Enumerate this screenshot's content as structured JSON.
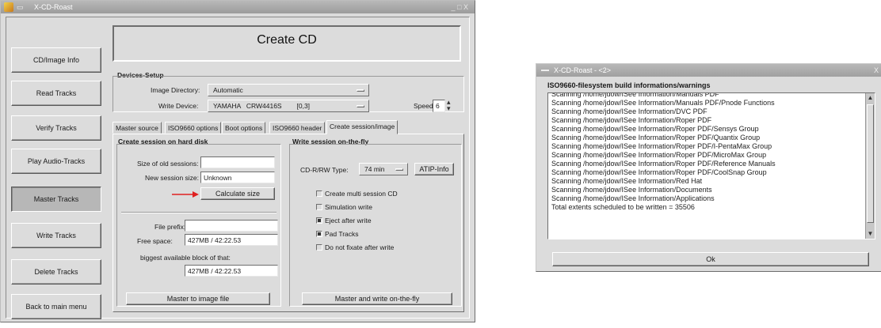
{
  "main_window": {
    "title": "X-CD-Roast",
    "title_controls": "_ □ X",
    "header_title": "Create CD",
    "nav": [
      {
        "label": "CD/Image Info",
        "active": false
      },
      {
        "label": "Read Tracks",
        "active": false
      },
      {
        "label": "Verify Tracks",
        "active": false
      },
      {
        "label": "Play Audio-Tracks",
        "active": false
      },
      {
        "label": "Master Tracks",
        "active": true
      },
      {
        "label": "Write Tracks",
        "active": false
      },
      {
        "label": "Delete Tracks",
        "active": false
      },
      {
        "label": "Back to main menu",
        "active": false
      }
    ],
    "devices": {
      "section_label": "Devices-Setup",
      "image_dir_label": "Image Directory:",
      "image_dir_value": "Automatic",
      "write_device_label": "Write Device:",
      "write_device_value": "YAMAHA   CRW4416S        [0,3]",
      "speed_label": "Speed:",
      "speed_value": "6"
    },
    "tabs": [
      "Master source",
      "ISO9660 options",
      "Boot options",
      "ISO9660 header",
      "Create session/image"
    ],
    "left_panel": {
      "title": "Create session on hard disk",
      "old_session_label": "Size of old sessions:",
      "old_session_value": "",
      "new_session_label": "New session size:",
      "new_session_value": "Unknown",
      "calc_button": "Calculate size",
      "file_prefix_label": "File prefix:",
      "file_prefix_value": "",
      "free_space_label": "Free space:",
      "free_space_value": "427MB / 42:22.53",
      "biggest_label": "biggest available block of that:",
      "biggest_value": "427MB / 42:22.53",
      "master_button": "Master to image file"
    },
    "right_panel": {
      "title": "Write session on-the-fly",
      "cd_type_label": "CD-R/RW Type:",
      "cd_type_value": "74 min",
      "atip_button": "ATIP-Info",
      "options": [
        {
          "label": "Create multi session CD",
          "checked": false
        },
        {
          "label": "Simulation write",
          "checked": false
        },
        {
          "label": "Eject after write",
          "checked": true
        },
        {
          "label": "Pad Tracks",
          "checked": true
        },
        {
          "label": "Do not fixate after write",
          "checked": false
        }
      ],
      "master_write_button": "Master and write on-the-fly"
    }
  },
  "dialog": {
    "title": "X-CD-Roast - <2>",
    "close_glyph": "X",
    "heading": "ISO9660-filesystem build informations/warnings",
    "lines": [
      "Scanning /home/jdow/ISee Information/Manuals PDF",
      "Scanning /home/jdow/ISee Information/Manuals PDF/Pnode Functions",
      "Scanning /home/jdow/ISee Information/DVC PDF",
      "Scanning /home/jdow/ISee Information/Roper PDF",
      "Scanning /home/jdow/ISee Information/Roper PDF/Sensys Group",
      "Scanning /home/jdow/ISee Information/Roper PDF/Quantix Group",
      "Scanning /home/jdow/ISee Information/Roper PDF/I-PentaMax Group",
      "Scanning /home/jdow/ISee Information/Roper PDF/MicroMax Group",
      "Scanning /home/jdow/ISee Information/Roper PDF/Reference Manuals",
      "Scanning /home/jdow/ISee Information/Roper PDF/CoolSnap Group",
      "Scanning /home/jdow/ISee Information/Red Hat",
      "Scanning /home/jdow/ISee Information/Documents",
      "Scanning /home/jdow/ISee Information/Applications",
      "Total extents scheduled to be written = 35506"
    ],
    "ok_button": "Ok"
  },
  "colors": {
    "titlebar": "#a9a9a9",
    "window_bg": "#dcdcdc",
    "arrow": "#e02020"
  }
}
